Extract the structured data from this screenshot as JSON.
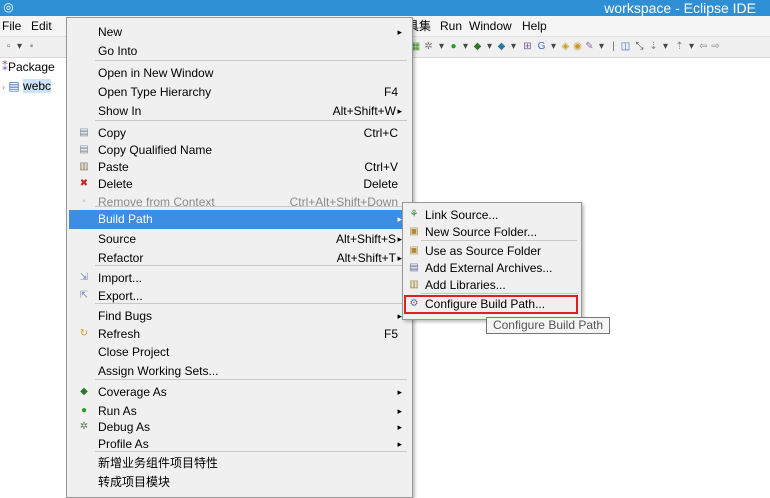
{
  "window": {
    "title": "workspace - Eclipse IDE",
    "app_icon": "eclipse-icon"
  },
  "menubar": [
    {
      "label": "File"
    },
    {
      "label": "Edit"
    },
    {
      "label": "具集"
    },
    {
      "label": "Run"
    },
    {
      "label": "Window"
    },
    {
      "label": "Help"
    }
  ],
  "explorer": {
    "header": "Package",
    "item": "webc"
  },
  "context_menu": {
    "items": [
      {
        "label": "New",
        "submenu": true
      },
      {
        "label": "Go Into"
      },
      {
        "label": "Open in New Window"
      },
      {
        "label": "Open Type Hierarchy",
        "shortcut": "F4"
      },
      {
        "label": "Show In",
        "shortcut": "Alt+Shift+W",
        "submenu": true
      },
      {
        "label": "Copy",
        "shortcut": "Ctrl+C",
        "icon": "copy-icon"
      },
      {
        "label": "Copy Qualified Name",
        "icon": "copy-qualified-icon"
      },
      {
        "label": "Paste",
        "shortcut": "Ctrl+V",
        "icon": "paste-icon"
      },
      {
        "label": "Delete",
        "shortcut": "Delete",
        "icon": "delete-icon"
      },
      {
        "label": "Remove from Context",
        "shortcut": "Ctrl+Alt+Shift+Down",
        "disabled": true,
        "icon": "remove-context-icon"
      },
      {
        "label": "Build Path",
        "submenu": true,
        "highlighted": true
      },
      {
        "label": "Source",
        "shortcut": "Alt+Shift+S",
        "submenu": true
      },
      {
        "label": "Refactor",
        "shortcut": "Alt+Shift+T",
        "submenu": true
      },
      {
        "label": "Import...",
        "icon": "import-icon"
      },
      {
        "label": "Export...",
        "icon": "export-icon"
      },
      {
        "label": "Find Bugs",
        "submenu": true
      },
      {
        "label": "Refresh",
        "shortcut": "F5",
        "icon": "refresh-icon"
      },
      {
        "label": "Close Project"
      },
      {
        "label": "Assign Working Sets..."
      },
      {
        "label": "Coverage As",
        "submenu": true,
        "icon": "coverage-icon"
      },
      {
        "label": "Run As",
        "submenu": true,
        "icon": "run-icon"
      },
      {
        "label": "Debug As",
        "submenu": true,
        "icon": "debug-icon"
      },
      {
        "label": "Profile As",
        "submenu": true
      },
      {
        "label": "新增业务组件项目特性"
      },
      {
        "label": "转成项目模块"
      }
    ]
  },
  "build_path_submenu": {
    "items": [
      {
        "label": "Link Source...",
        "icon": "link-source-icon"
      },
      {
        "label": "New Source Folder...",
        "icon": "new-source-folder-icon"
      },
      {
        "label": "Use as Source Folder",
        "icon": "source-folder-icon"
      },
      {
        "label": "Add External Archives...",
        "icon": "archive-icon"
      },
      {
        "label": "Add Libraries...",
        "icon": "libraries-icon"
      },
      {
        "label": "Configure Build Path...",
        "icon": "configure-build-path-icon"
      }
    ],
    "tooltip": "Configure Build Path"
  },
  "colors": {
    "title_bar": "#2e8fd4",
    "highlight": "#3d8ee3",
    "focus_box": "#e02020"
  }
}
